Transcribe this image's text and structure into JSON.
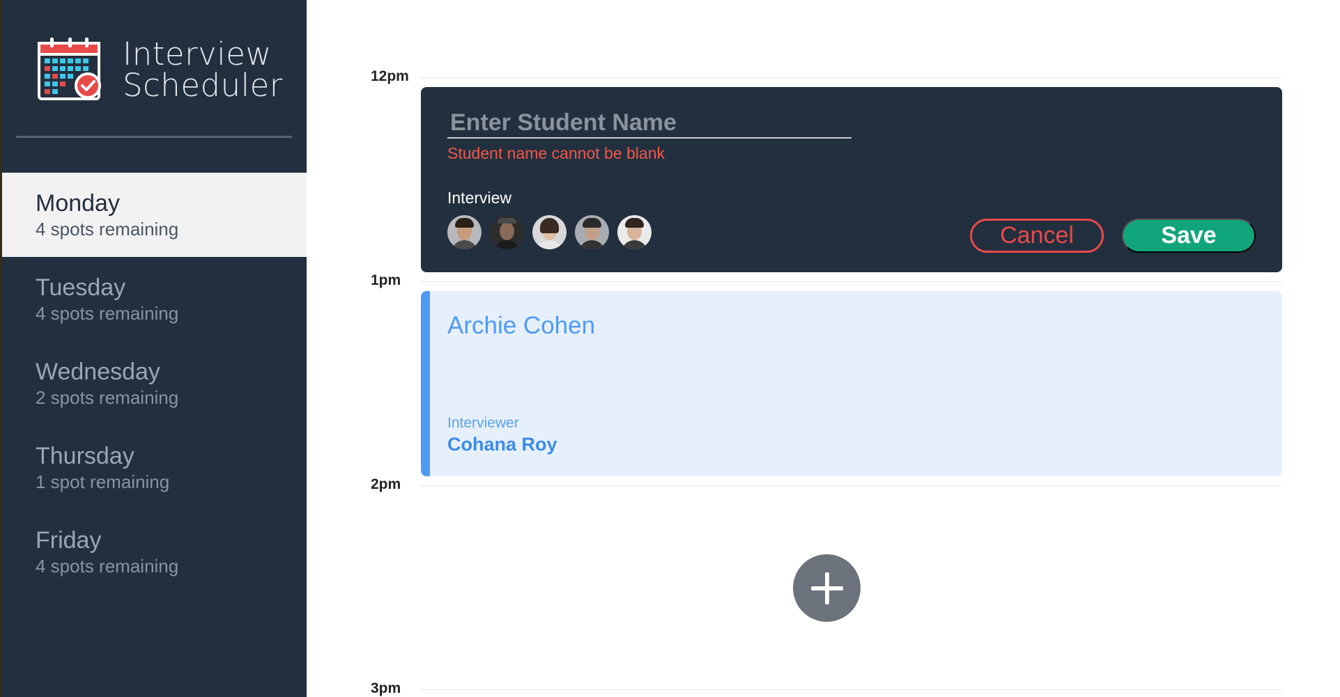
{
  "app": {
    "title_line1": "Interview",
    "title_line2": "Scheduler"
  },
  "days": [
    {
      "name": "Monday",
      "spots": "4 spots remaining",
      "selected": true
    },
    {
      "name": "Tuesday",
      "spots": "4 spots remaining",
      "selected": false
    },
    {
      "name": "Wednesday",
      "spots": "2 spots remaining",
      "selected": false
    },
    {
      "name": "Thursday",
      "spots": "1 spot remaining",
      "selected": false
    },
    {
      "name": "Friday",
      "spots": "4 spots remaining",
      "selected": false
    }
  ],
  "times": [
    "12pm",
    "1pm",
    "2pm",
    "3pm"
  ],
  "form": {
    "name_placeholder": "Enter Student Name",
    "name_value": "",
    "error": "Student name cannot be blank",
    "interviewer_label": "Interview",
    "avatars": [
      "interviewer-avatar-1",
      "interviewer-avatar-2",
      "interviewer-avatar-3",
      "interviewer-avatar-4",
      "interviewer-avatar-5"
    ],
    "cancel_label": "Cancel",
    "save_label": "Save"
  },
  "booked": {
    "student": "Archie Cohen",
    "interviewer_caption": "Interviewer",
    "interviewer": "Cohana Roy"
  },
  "colors": {
    "sidebar": "#222f3e",
    "accent_blue": "#4f9af5",
    "save_green": "#11a57b",
    "cancel_red": "#e84a4a",
    "error_red": "#f0584a"
  },
  "icons": {
    "logo": "calendar-check-icon",
    "add": "plus-icon"
  }
}
